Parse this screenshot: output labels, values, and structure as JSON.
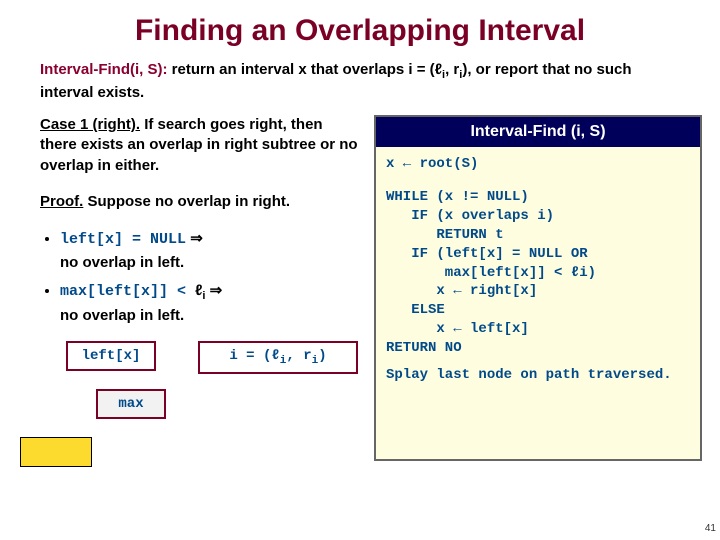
{
  "title": "Finding an Overlapping Interval",
  "intro": {
    "fn": "Interval-Find(i, S):",
    "text_a": "return an interval x that overlaps i = (",
    "ell": "ℓ",
    "sub": "i",
    "text_b": ", r",
    "text_c": "), or report that no such interval exists."
  },
  "left": {
    "case_label": "Case 1 (right).",
    "case_text": "If search goes right, then there exists an overlap in right subtree or no overlap in either.",
    "proof_label": "Proof.",
    "proof_text": "Suppose no overlap in right.",
    "bullet1": {
      "a": "left[x] = NULL",
      "imp": " ⇒",
      "b": "no overlap in left."
    },
    "bullet2": {
      "a": "max[left[x]] < ",
      "ell": "ℓ",
      "sub": "i",
      "imp": " ⇒",
      "b": "no overlap in left."
    },
    "diag": {
      "left": "left[x]",
      "right_a": "i = (",
      "right_ell": "ℓ",
      "right_sub": "i",
      "right_b": ", r",
      "right_c": ")",
      "max": "max"
    }
  },
  "algo": {
    "header": "Interval-Find (i, S)",
    "line1": "x ← root(S)",
    "body": "WHILE (x != NULL)\n   IF (x overlaps i)\n      RETURN t\n   IF (left[x] = NULL OR\n       max[left[x]] < ℓi)\n      x ← right[x]\n   ELSE\n      x ← left[x]\nRETURN NO",
    "splay": "Splay last node on path traversed."
  },
  "pagenum": "41"
}
